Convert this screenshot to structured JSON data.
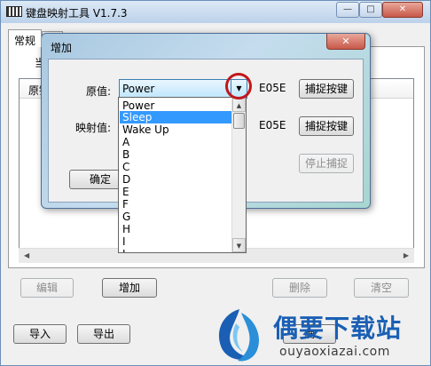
{
  "window": {
    "title": "键盘映射工具 V1.7.3",
    "min_glyph": "—",
    "max_glyph": "□",
    "close_glyph": "✕"
  },
  "tabs": [
    "常规",
    "..."
  ],
  "behind_tab_text": "当",
  "list": {
    "header": "原键"
  },
  "buttons": {
    "edit": "编辑",
    "add": "增加",
    "delete": "删除",
    "clear": "清空",
    "import": "导入",
    "export": "导出",
    "hidden_label": "确"
  },
  "dialog": {
    "title": "增加",
    "close_glyph": "✕",
    "original_label": "原值:",
    "original_value": "Power",
    "original_code": "E05E",
    "capture_button": "捕捉按键",
    "mapped_label": "映射值:",
    "mapped_code": "E05E",
    "capture_button_2": "捕捉按键",
    "stop_capture": "停止捕捉",
    "ok_button": "确定"
  },
  "dropdown": {
    "items": [
      "Power",
      "Sleep",
      "Wake Up",
      "A",
      "B",
      "C",
      "D",
      "E",
      "F",
      "G",
      "H",
      "I",
      "J"
    ],
    "selected_index": 1
  },
  "watermark": {
    "brand": "偶要下载站",
    "url": "ouyaoxiazai.com"
  },
  "colors": {
    "selection": "#3399ff",
    "highlight_circle": "#c2161c",
    "brand_blue": "#1a5fb4"
  }
}
